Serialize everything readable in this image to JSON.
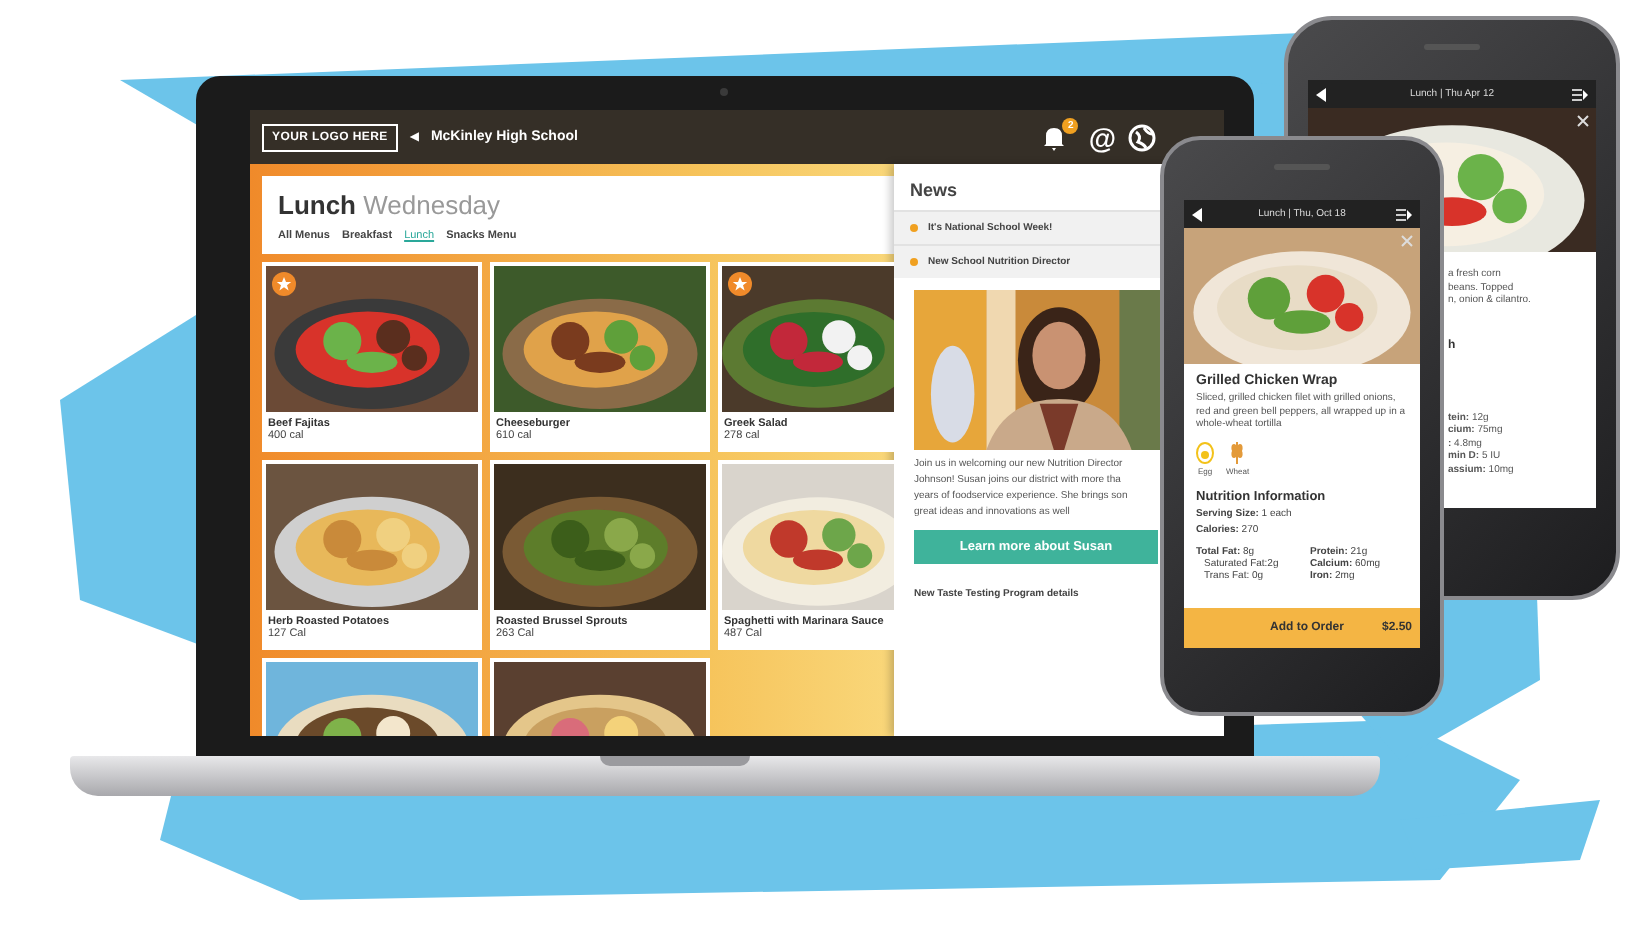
{
  "laptop": {
    "logo": "YOUR LOGO HERE",
    "back_arrow": "◀",
    "school": "McKinley High School",
    "notification_count": "2",
    "at_sign": "@",
    "menu": {
      "title": "Lunch",
      "day": "Wednesday",
      "tabs": [
        {
          "label": "All Menus",
          "selected": false
        },
        {
          "label": "Breakfast",
          "selected": false
        },
        {
          "label": "Lunch",
          "selected": true
        },
        {
          "label": "Snacks Menu",
          "selected": false
        }
      ]
    },
    "items": [
      {
        "name": "Beef Fajitas",
        "calories": "400 cal",
        "featured": true
      },
      {
        "name": "Cheeseburger",
        "calories": "610 cal",
        "featured": false
      },
      {
        "name": "Greek Salad",
        "calories": "278 cal",
        "featured": true
      },
      {
        "name": "Herb Roasted Potatoes",
        "calories": "127 Cal",
        "featured": false
      },
      {
        "name": "Roasted Brussel Sprouts",
        "calories": "263 Cal",
        "featured": false
      },
      {
        "name": "Spaghetti with Marinara Sauce",
        "calories": "487 Cal",
        "featured": false
      }
    ],
    "news": {
      "title": "News",
      "items": [
        {
          "title": "It's National School Week!"
        },
        {
          "title": "New School Nutrition Director"
        }
      ],
      "feature": {
        "body_lines": [
          "Join us in welcoming our new Nutrition Director",
          "Johnson! Susan joins our district with more tha",
          "years of foodservice experience. She brings son",
          "great ideas and innovations as well"
        ],
        "button": "Learn more about Susan"
      },
      "footer_item": "New Taste Testing Program details"
    }
  },
  "phone_front": {
    "header": "Lunch | Thu, Oct 18",
    "title": "Grilled Chicken Wrap",
    "description": "Sliced, grilled chicken filet with grilled onions, red and green bell peppers, all wrapped up in a whole-wheat tortilla",
    "allergens": [
      {
        "kind": "egg",
        "label": "Egg"
      },
      {
        "kind": "wheat",
        "label": "Wheat"
      }
    ],
    "nutrition_title": "Nutrition Information",
    "summary": [
      "**Serving Size:** 1 each",
      "**Calories:** 270"
    ],
    "left_column": [
      {
        "text": "**Total Fat:** 8g",
        "indent": false
      },
      {
        "text": "Saturated Fat:2g",
        "indent": true
      },
      {
        "text": "Trans Fat: 0g",
        "indent": true
      }
    ],
    "right_column": [
      "**Protein:** 21g",
      "**Calcium:** 60mg",
      "**Iron:** 2mg"
    ],
    "order_button": "Add to Order",
    "price": "$2.50"
  },
  "phone_back": {
    "header": "Lunch | Thu Apr 12",
    "description_lines": [
      "a fresh corn",
      "beans. Topped",
      "n, onion & cilantro."
    ],
    "heading_fragment": "h",
    "nutrient_lines": [
      "**tein:** 12g",
      "**cium:** 75mg",
      "**:** 4.8mg",
      "**min D:** 5 IU",
      "**assium:** 10mg"
    ]
  }
}
